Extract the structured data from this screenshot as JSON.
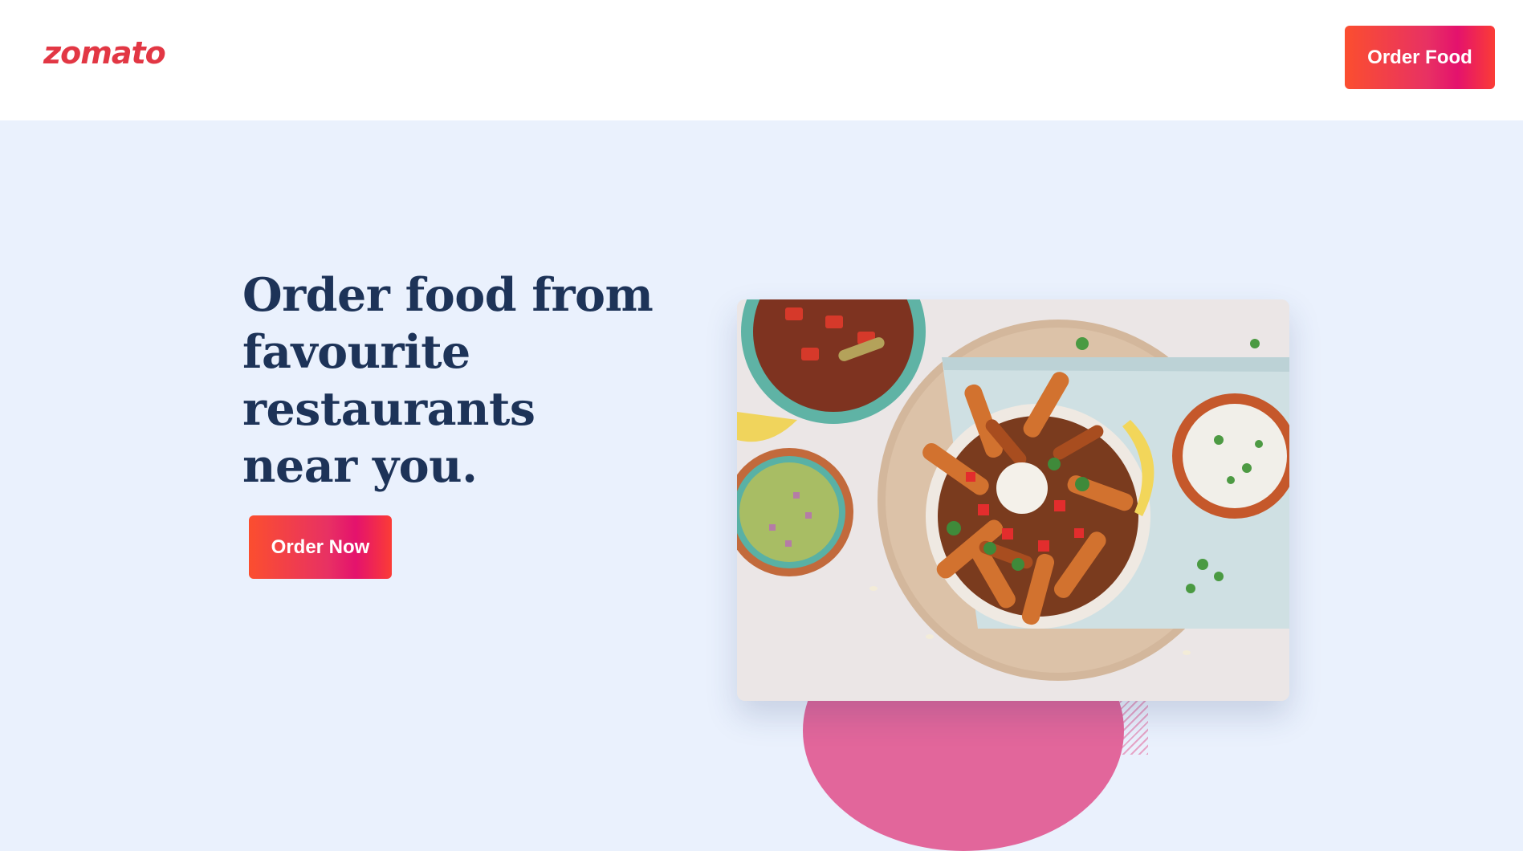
{
  "header": {
    "logo_text": "zomato",
    "order_food_label": "Order Food"
  },
  "hero": {
    "title": "Order food from favourite restaurants near you.",
    "cta_label": "Order Now",
    "image_icon": "food-bowl-photo"
  },
  "colors": {
    "brand_red": "#e23744",
    "gradient_start": "#fb4e2f",
    "gradient_mid": "#e4126d",
    "title_navy": "#1d3358",
    "hero_bg": "#eaf1fd"
  }
}
